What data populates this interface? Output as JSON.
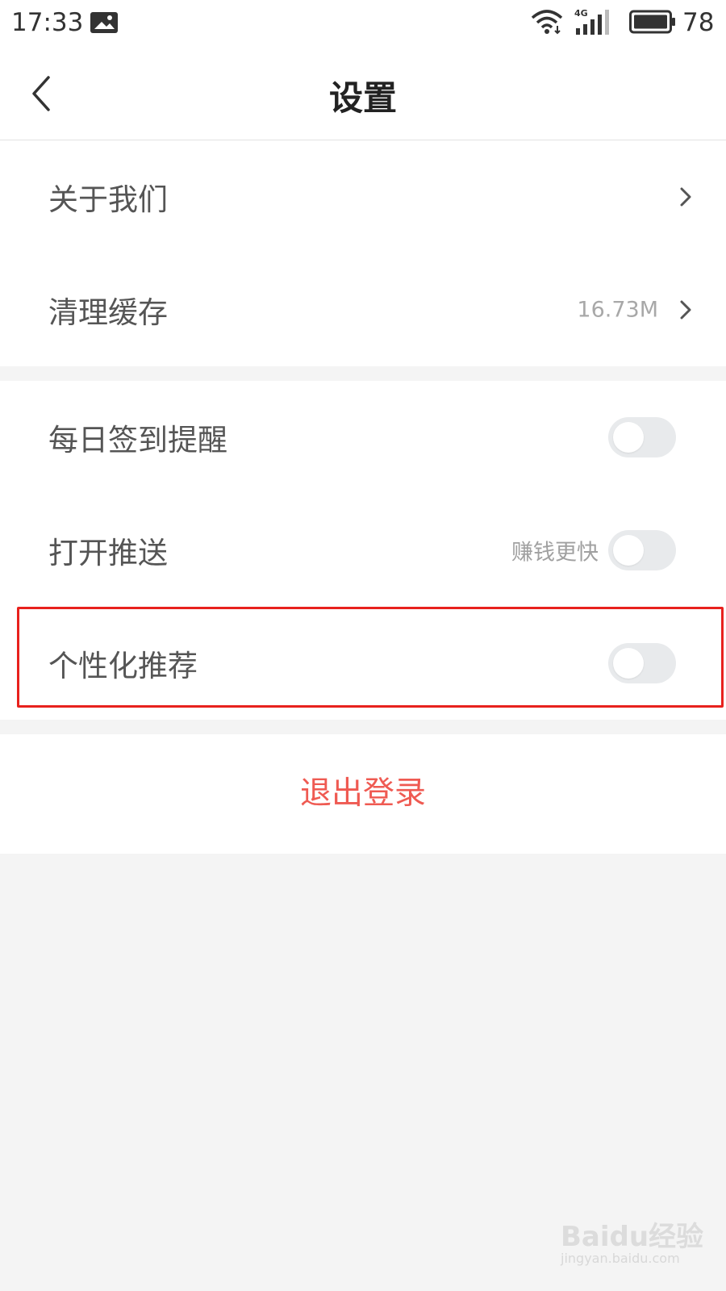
{
  "status_bar": {
    "time": "17:33",
    "network": "4G",
    "battery": "78"
  },
  "header": {
    "title": "设置"
  },
  "settings_group_1": [
    {
      "label": "关于我们",
      "value": ""
    },
    {
      "label": "清理缓存",
      "value": "16.73M"
    }
  ],
  "settings_group_2": [
    {
      "label": "每日签到提醒",
      "hint": "",
      "enabled": false
    },
    {
      "label": "打开推送",
      "hint": "赚钱更快",
      "enabled": false
    },
    {
      "label": "个性化推荐",
      "hint": "",
      "enabled": false
    }
  ],
  "logout_label": "退出登录",
  "colors": {
    "highlight_border": "#e8211d",
    "logout_text": "#ef5a52",
    "toggle_off": "#e8eaec",
    "background": "#f4f4f4"
  },
  "watermark": {
    "text": "Baidu经验",
    "subtext": "jingyan.baidu.com"
  }
}
